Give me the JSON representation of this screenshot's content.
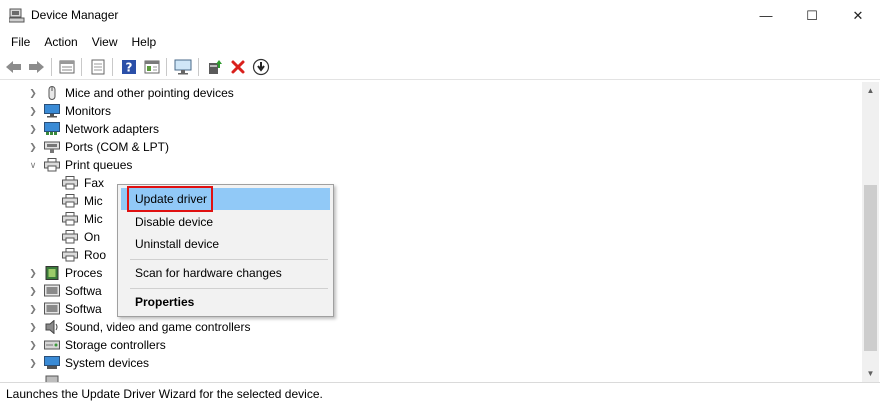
{
  "window": {
    "title": "Device Manager",
    "minimize_glyph": "—",
    "maximize_glyph": "☐",
    "close_glyph": "✕"
  },
  "menubar": {
    "items": [
      "File",
      "Action",
      "View",
      "Help"
    ]
  },
  "toolbar": {
    "buttons": [
      "back-icon",
      "forward-icon",
      "properties-list-icon",
      "grid-icon",
      "help-icon",
      "details-icon",
      "monitor-icon",
      "add-driver-icon",
      "remove-icon",
      "download-icon"
    ]
  },
  "tree": {
    "items": [
      {
        "label": "Mice and other pointing devices",
        "expanded": false,
        "icon": "mouse-icon"
      },
      {
        "label": "Monitors",
        "expanded": false,
        "icon": "monitor-icon"
      },
      {
        "label": "Network adapters",
        "expanded": false,
        "icon": "network-adapter-icon"
      },
      {
        "label": "Ports (COM & LPT)",
        "expanded": false,
        "icon": "port-icon"
      },
      {
        "label": "Print queues",
        "expanded": true,
        "icon": "printer-icon"
      },
      {
        "label": "Fax",
        "child": true,
        "icon": "printer-icon"
      },
      {
        "label": "Mic",
        "child": true,
        "icon": "printer-icon"
      },
      {
        "label": "Mic",
        "child": true,
        "icon": "printer-icon"
      },
      {
        "label": "On",
        "child": true,
        "icon": "printer-icon"
      },
      {
        "label": "Roo",
        "child": true,
        "icon": "printer-icon"
      },
      {
        "label": "Proces",
        "expanded": false,
        "icon": "processor-icon"
      },
      {
        "label": "Softwa",
        "expanded": false,
        "icon": "software-device-icon"
      },
      {
        "label": "Softwa",
        "expanded": false,
        "icon": "software-device-icon"
      },
      {
        "label": "Sound, video and game controllers",
        "expanded": false,
        "icon": "speaker-icon"
      },
      {
        "label": "Storage controllers",
        "expanded": false,
        "icon": "storage-icon"
      },
      {
        "label": "System devices",
        "expanded": false,
        "icon": "system-device-icon"
      }
    ]
  },
  "context_menu": {
    "items": [
      {
        "label": "Update driver",
        "highlighted": true
      },
      {
        "label": "Disable device"
      },
      {
        "label": "Uninstall device"
      },
      {
        "label": "Scan for hardware changes"
      },
      {
        "label": "Properties",
        "bold": true
      }
    ]
  },
  "statusbar": {
    "text": "Launches the Update Driver Wizard for the selected device."
  },
  "colors": {
    "menu_hover": "#91c9f7",
    "highlight_box": "#e01010",
    "remove_red": "#d9201c",
    "help_blue": "#2a4fa8"
  }
}
